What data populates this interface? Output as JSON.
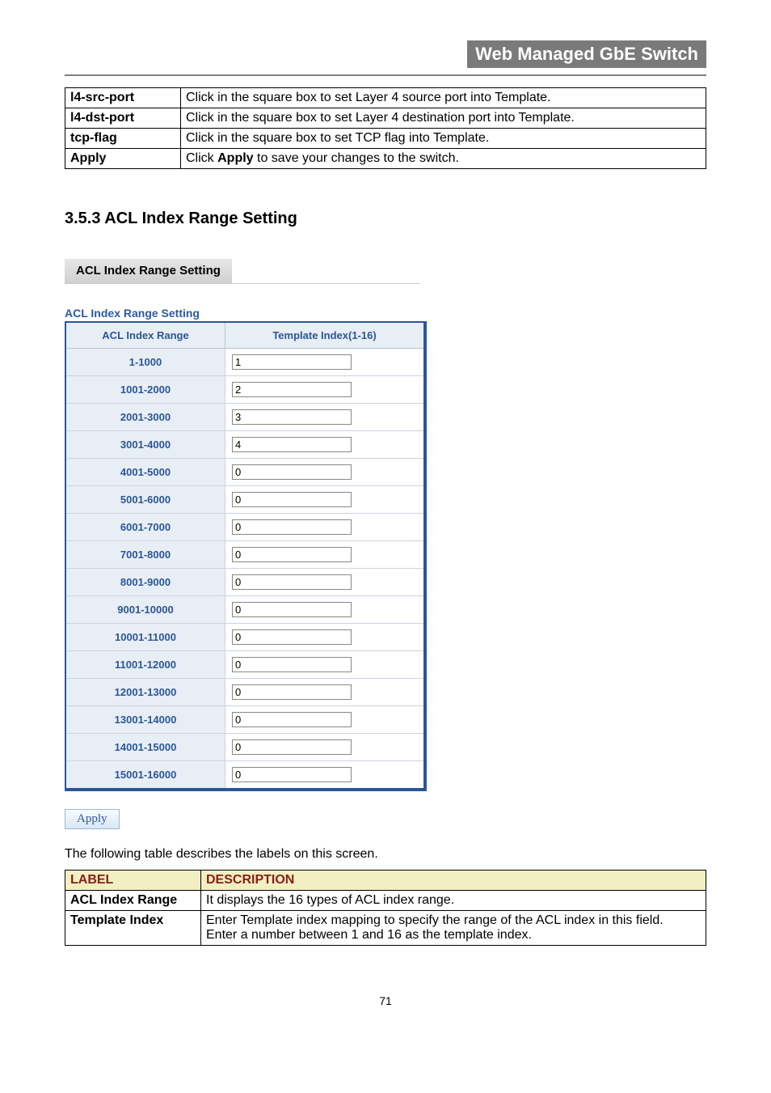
{
  "header": {
    "title": "Web Managed GbE Switch"
  },
  "topTable": [
    {
      "label": "l4-src-port",
      "desc": "Click in the square box to set Layer 4 source port into Template."
    },
    {
      "label": "l4-dst-port",
      "desc": "Click in the square box to set Layer 4 destination port into Template."
    },
    {
      "label": "tcp-flag",
      "desc": "Click in the square box to set TCP flag into Template."
    },
    {
      "label": "Apply",
      "descPrefix": "Click ",
      "descBold": "Apply",
      "descSuffix": " to save your changes to the switch."
    }
  ],
  "section": {
    "heading": "3.5.3 ACL Index Range Setting",
    "tabLabel": "ACL Index Range Setting",
    "caption": "ACL Index Range Setting",
    "colRange": "ACL Index Range",
    "colTemplate": "Template Index(1-16)",
    "applyLabel": "Apply",
    "rows": [
      {
        "range": "1-1000",
        "value": "1"
      },
      {
        "range": "1001-2000",
        "value": "2"
      },
      {
        "range": "2001-3000",
        "value": "3"
      },
      {
        "range": "3001-4000",
        "value": "4"
      },
      {
        "range": "4001-5000",
        "value": "0"
      },
      {
        "range": "5001-6000",
        "value": "0"
      },
      {
        "range": "6001-7000",
        "value": "0"
      },
      {
        "range": "7001-8000",
        "value": "0"
      },
      {
        "range": "8001-9000",
        "value": "0"
      },
      {
        "range": "9001-10000",
        "value": "0"
      },
      {
        "range": "10001-11000",
        "value": "0"
      },
      {
        "range": "11001-12000",
        "value": "0"
      },
      {
        "range": "12001-13000",
        "value": "0"
      },
      {
        "range": "13001-14000",
        "value": "0"
      },
      {
        "range": "14001-15000",
        "value": "0"
      },
      {
        "range": "15001-16000",
        "value": "0"
      }
    ]
  },
  "descText": "The following table describes the labels on this screen.",
  "labelTable": {
    "headLabel": "LABEL",
    "headDesc": "DESCRIPTION",
    "rows": [
      {
        "label": "ACL Index Range",
        "desc": "It displays the 16 types of ACL index range."
      },
      {
        "label": "Template Index",
        "desc": "Enter Template index mapping to specify the range of the ACL index in this field.\nEnter a number between 1 and 16 as the template index."
      }
    ]
  },
  "pageNumber": "71"
}
